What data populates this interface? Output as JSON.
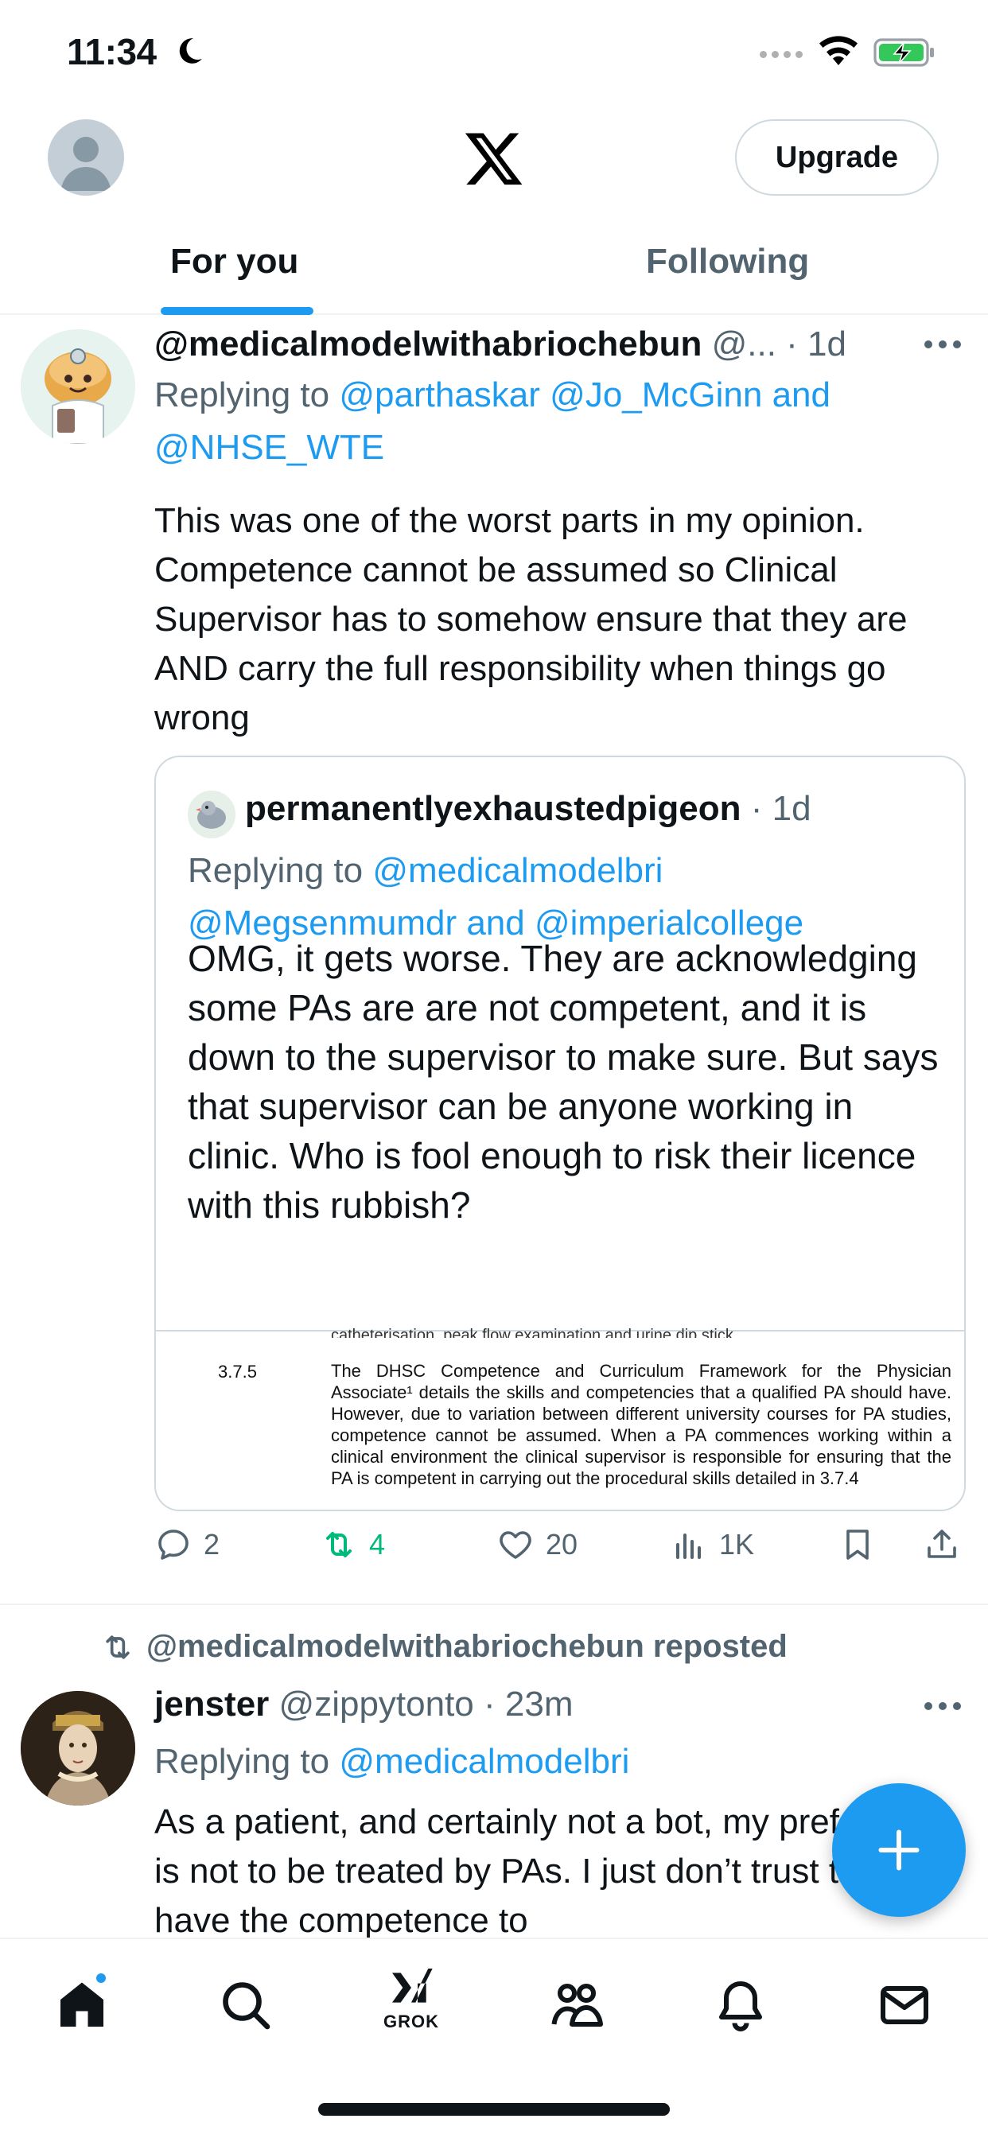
{
  "status_bar": {
    "time": "11:34"
  },
  "top_bar": {
    "upgrade_label": "Upgrade"
  },
  "tabs": [
    {
      "label": "For you",
      "active": true
    },
    {
      "label": "Following",
      "active": false
    }
  ],
  "tweets": [
    {
      "display_name": "@medicalmodelwithabriochebun",
      "handle": "@...",
      "time": "1d",
      "replying_prefix": "Replying to",
      "replying_links_line1": "@parthaskar @Jo_McGinn and",
      "replying_links_line2": "@NHSE_WTE",
      "text": "This was one of the worst parts in my opinion. Competence cannot be assumed so Clinical Supervisor has to somehow ensure that they are AND carry the full responsibility when things go wrong",
      "quote": {
        "display_name": "permanentlyexhaustedpigeon",
        "time": "1d",
        "replying_prefix": "Replying to",
        "replying_links_line1": "@medicalmodelbri",
        "replying_links_line2": "@Megsenmumdr and @imperialcollege",
        "text": "OMG, it gets worse. They are acknowledging some PAs are are not competent, and it is down to the supervisor to make sure. But says that supervisor can be anyone working in clinic. Who is fool enough to risk their licence with this rubbish?",
        "image": {
          "clipped_line": "catheterisation, peak flow examination and urine dip stick.",
          "section_number": "3.7.5",
          "section_text": "The DHSC Competence and Curriculum Framework for the Physician Associate¹ details the skills and competencies that a qualified PA should have. However, due to variation between different university courses for PA studies, competence cannot be assumed. When a PA commences working within a clinical environment the clinical supervisor is responsible for ensuring that the PA is competent in carrying out the procedural skills detailed in 3.7.4"
        }
      },
      "actions": {
        "replies": "2",
        "reposts": "4",
        "likes": "20",
        "views": "1K"
      },
      "colors": {
        "repost_active": "#00ba7c",
        "link": "#1d9bf0"
      }
    },
    {
      "repost_label": "@medicalmodelwithabriochebun reposted",
      "display_name": "jenster",
      "handle": "@zippytonto",
      "time": "23m",
      "replying_prefix": "Replying to",
      "replying_links_line1": "@medicalmodelbri",
      "text": "As a patient, and certainly not a bot, my preference is not to be treated by PAs. I just don’t trust them to have the competence to"
    }
  ],
  "bottom_nav": {
    "items": [
      {
        "icon": "home-icon",
        "active": true,
        "badge": true
      },
      {
        "icon": "search-icon"
      },
      {
        "icon": "grok-icon",
        "label": "GROK"
      },
      {
        "icon": "communities-icon"
      },
      {
        "icon": "notifications-icon"
      },
      {
        "icon": "messages-icon"
      }
    ]
  },
  "fab": {
    "icon": "compose-plus-icon"
  }
}
